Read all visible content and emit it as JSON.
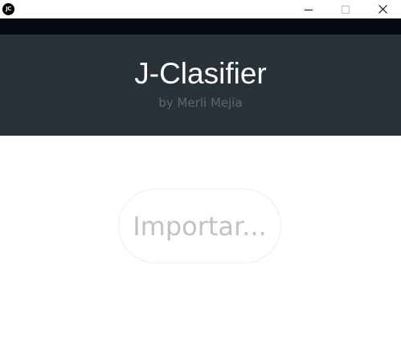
{
  "window": {
    "icon_label": "JC",
    "controls": {
      "minimize_icon": "minimize-icon",
      "maximize_icon": "maximize-icon",
      "close_icon": "close-icon"
    }
  },
  "header": {
    "title": "J-Clasifier",
    "subtitle": "by Merli Mejia"
  },
  "main": {
    "import_button_label": "Importar..."
  },
  "colors": {
    "header_bg": "#283238",
    "top_strip": "#050b10",
    "title_text": "#ffffff",
    "subtitle_text": "#5c666c",
    "button_text": "#c2c2c2",
    "button_border": "#ececec"
  }
}
